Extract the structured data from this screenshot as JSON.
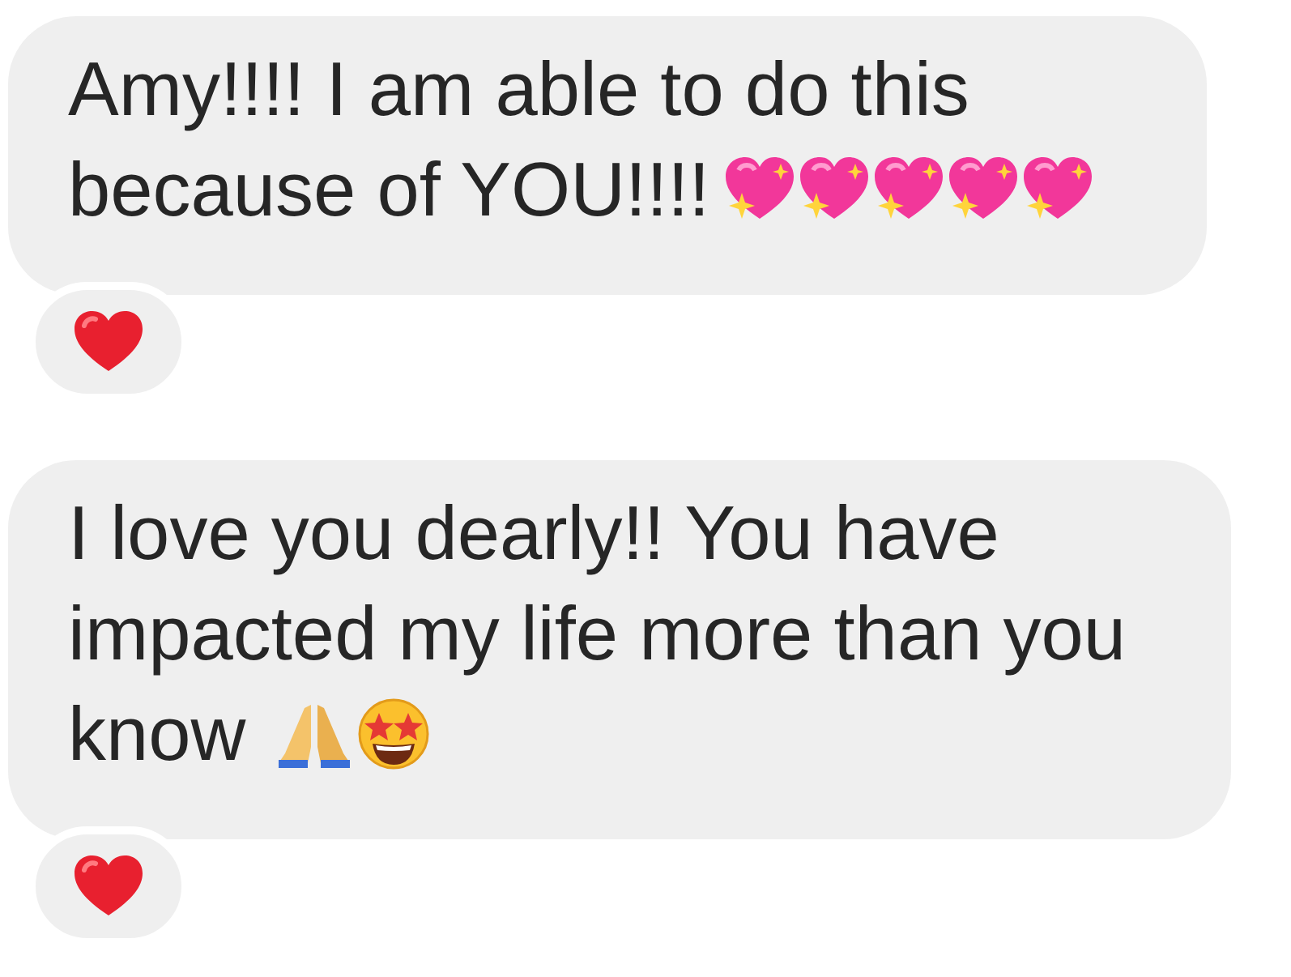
{
  "messages": [
    {
      "lines": [
        "Amy!!!! I am able to do this",
        "because of YOU!!!!"
      ],
      "emojis": [
        {
          "kind": "sparkling_heart"
        },
        {
          "kind": "sparkling_heart"
        },
        {
          "kind": "sparkling_heart"
        },
        {
          "kind": "sparkling_heart"
        },
        {
          "kind": "sparkling_heart"
        }
      ],
      "reaction": {
        "kind": "heart"
      }
    },
    {
      "lines": [
        "I love you dearly!! You have",
        "impacted my life more than you",
        "know"
      ],
      "emojis": [
        {
          "kind": "folded_hands"
        },
        {
          "kind": "star_struck"
        }
      ],
      "reaction": {
        "kind": "heart"
      }
    }
  ]
}
